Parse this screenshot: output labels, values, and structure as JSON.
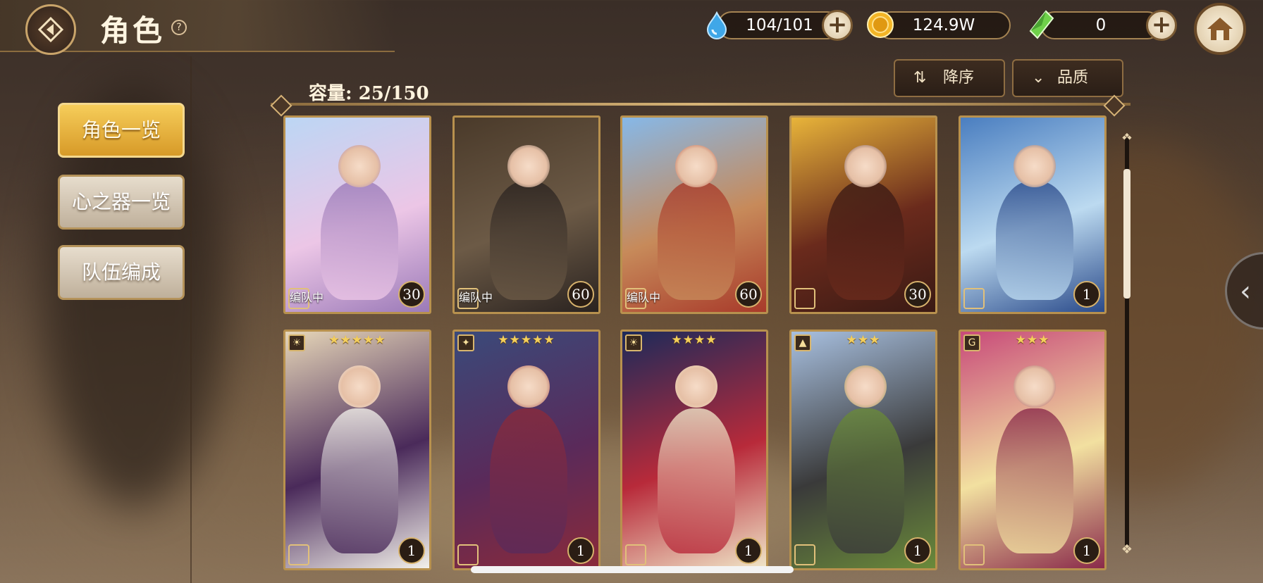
{
  "header": {
    "title": "角色",
    "help_symbol": "?"
  },
  "currencies": [
    {
      "name": "stamina",
      "icon": "water-drop-icon",
      "value": "104/101",
      "has_plus": true
    },
    {
      "name": "gold",
      "icon": "gold-coin-icon",
      "value": "124.9W",
      "has_plus": false
    },
    {
      "name": "crystal",
      "icon": "green-crystal-icon",
      "value": "0",
      "has_plus": true
    }
  ],
  "sort_button": {
    "icon": "sort-desc-icon",
    "label": "降序"
  },
  "quality_button": {
    "icon": "chevron-down-icon",
    "label": "品质"
  },
  "capacity": "容量: 25/150",
  "nav": [
    {
      "label": "角色一览",
      "active": true
    },
    {
      "label": "心之器一览",
      "active": false
    },
    {
      "label": "队伍编成",
      "active": false
    }
  ],
  "cards_row1": [
    {
      "level": "30",
      "team": "编队中",
      "palette": [
        "#bcd6f4",
        "#ecc6e6",
        "#9b7ab8"
      ]
    },
    {
      "level": "60",
      "team": "编队中",
      "palette": [
        "#4a3a2a",
        "#6c5a46",
        "#2a2320"
      ]
    },
    {
      "level": "60",
      "team": "编队中",
      "palette": [
        "#86b8e8",
        "#c78a5a",
        "#a83a2a"
      ]
    },
    {
      "level": "30",
      "team": "",
      "palette": [
        "#e8b43a",
        "#6a2a1c",
        "#3a1a14"
      ]
    },
    {
      "level": "1",
      "team": "",
      "palette": [
        "#4a7ec0",
        "#bcdaf0",
        "#2a4a8a"
      ]
    }
  ],
  "cards_row2": [
    {
      "level": "1",
      "stars": "★★★★★",
      "element": "☀",
      "palette": [
        "#e6d6b8",
        "#4a2a5a",
        "#f2f0ea"
      ]
    },
    {
      "level": "1",
      "stars": "★★★★★",
      "element": "✦",
      "palette": [
        "#3a4a7a",
        "#5a2a5a",
        "#8a2a3a"
      ]
    },
    {
      "level": "1",
      "stars": "★★★★",
      "element": "☀",
      "palette": [
        "#1c2a5a",
        "#b82a3a",
        "#f0e6c8"
      ]
    },
    {
      "level": "1",
      "stars": "★★★",
      "element": "▲",
      "palette": [
        "#a8c0e0",
        "#3a3a3a",
        "#6a8a3a"
      ]
    },
    {
      "level": "1",
      "stars": "★★★",
      "element": "G",
      "palette": [
        "#c84a7a",
        "#f2e0a0",
        "#8a2a4a"
      ]
    }
  ]
}
